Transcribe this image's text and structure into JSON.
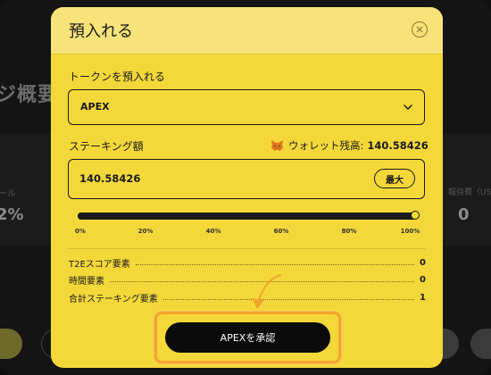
{
  "background": {
    "section_title": "ジ概要",
    "left_stat": {
      "label": "ール",
      "value": "2%"
    },
    "right_stat": {
      "label": "報待費（USDC",
      "value": "0"
    }
  },
  "modal": {
    "title": "預入れる",
    "close_icon": "close-circle-icon",
    "token_label": "トークンを預入れる",
    "token_selected": "APEX",
    "stake_label": "ステーキング額",
    "wallet_icon": "metamask-fox-icon",
    "wallet_label": "ウォレット残高:",
    "wallet_balance": "140.58426",
    "amount_value": "140.58426",
    "max_label": "最大",
    "slider": {
      "percent": 100,
      "ticks": [
        "0%",
        "20%",
        "40%",
        "60%",
        "80%",
        "100%"
      ]
    },
    "stats": [
      {
        "label": "T2Eスコア要素",
        "value": "0"
      },
      {
        "label": "時間要素",
        "value": "0"
      },
      {
        "label": "合計ステーキング要素",
        "value": "1"
      }
    ],
    "approve_label": "APEXを承認"
  },
  "colors": {
    "modal_bg": "#f4d83a",
    "modal_header_bg": "#f7e37a",
    "button_bg": "#0b0b0b",
    "highlight": "#f2a52e",
    "page_bg": "#141414"
  }
}
